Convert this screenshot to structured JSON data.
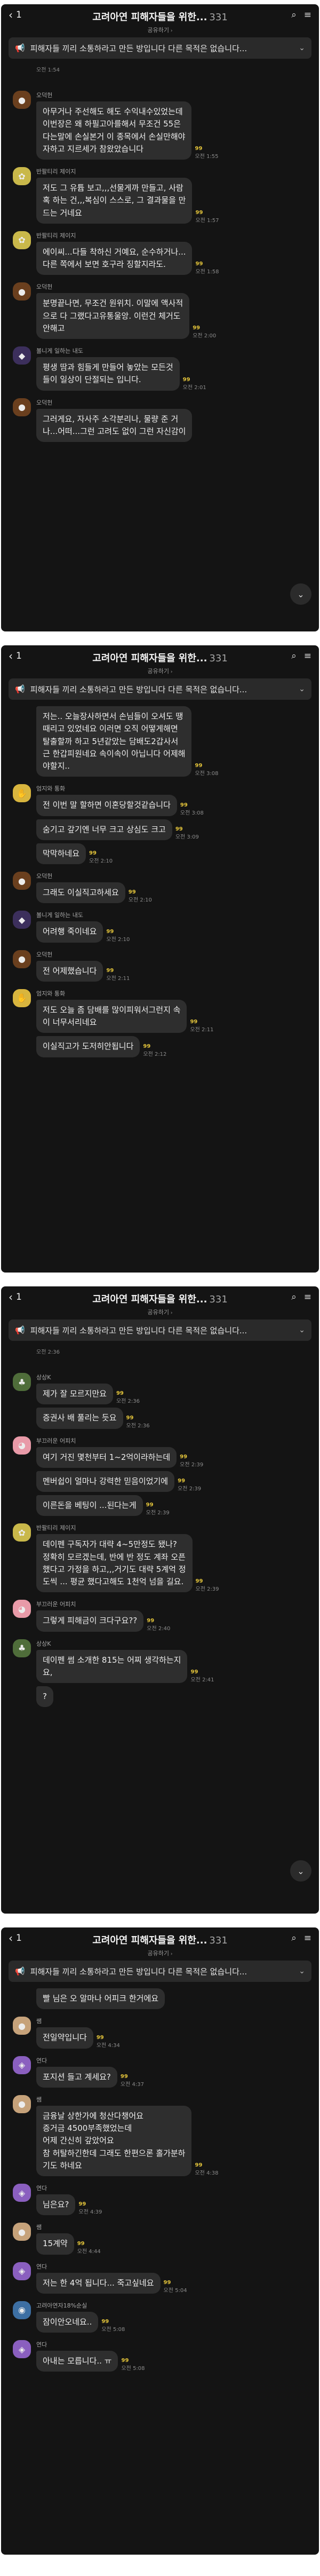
{
  "panels": [
    {
      "header": {
        "back_label": "1",
        "title": "고려아연 피해자들을 위한...",
        "count": "331",
        "subtitle": "공유하기"
      },
      "notice": "피해자들 끼리  소통하라고 만든 방입니다 다른 목적은 없습니다...",
      "messages": [
        {
          "sender": "",
          "text": "",
          "unread": "",
          "time": "오전 1:54",
          "avatar": "",
          "color": ""
        },
        {
          "sender": "오덕헌",
          "text": "아무거나 주선해도 해도 수익내수있었는데\n이번장은 왜 하필고아를해서 무조건 55은\n다는말에 손실본거 이 종목에서 손실만해야\n자하고 지르세가 참왔았습니다",
          "unread": "99",
          "time": "오전 1:55",
          "avatar": "●",
          "color": "#6a3f1e"
        },
        {
          "sender": "반팔티리 제이지",
          "text": "저도 그 유튭 보고,,,선물게까 만들고, 사람\n혹 하는 건,,,복심이 스스로, 그 결과물을 만\n드는 거네요",
          "unread": "99",
          "time": "오전 1:57",
          "avatar": "✿",
          "color": "#c9b84a"
        },
        {
          "sender": "반팔티리 제이지",
          "text": "에이씨...다들 착하신 거예요, 순수하거나...\n다른 쪽에서 보면 호구라 징할지라도.",
          "unread": "99",
          "time": "오전 1:58",
          "avatar": "✿",
          "color": "#c9b84a"
        },
        {
          "sender": "오덕헌",
          "text": "분명끝나면, 무조건 원위치. 이말에 액사적\n으로 다 그랬다고유통울앙. 이런건 체거도\n안해고",
          "unread": "99",
          "time": "오전 2:00",
          "avatar": "●",
          "color": "#6a3f1e"
        },
        {
          "sender": "볼니게 일하는 내도",
          "text": "평생 땀과 힘들게 만들어 놓았는 모든것\n들이 일상이 단절되는 입니다.",
          "unread": "99",
          "time": "오전 2:01",
          "avatar": "◆",
          "color": "#3c2f5c"
        },
        {
          "sender": "오덕헌",
          "text": "그러게요, 자사주 소각분리나, 물량 준 거\n나...어떠...그런 고려도 없이 그런 자신감이",
          "unread": "",
          "time": "",
          "avatar": "●",
          "color": "#6a3f1e"
        }
      ]
    },
    {
      "header": {
        "back_label": "1",
        "title": "고려아연 피해자들을 위한...",
        "count": "331",
        "subtitle": "공유하기"
      },
      "notice": "피해자들 끼리  소통하라고 만든 방입니다 다른 목적은 없습니다...",
      "messages": [
        {
          "sender": "",
          "text": "저는.. 오늘장사하면서 손님들이 오셔도 땡\n때리고 있었네요 이러면 오직 어떻게해면\n탈출할까 하고 5년같았는 담배도2갑사서\n근 한갑피원네요 속이속이 아닙니다 어제해\n야할지..",
          "unread": "99",
          "time": "오전 3:08",
          "avatar": "",
          "color": ""
        },
        {
          "sender": "엄지와 통화",
          "text": "전 이번 말 할하면 이혼당할것같습니다",
          "unread": "99",
          "time": "오전 3:08",
          "avatar": "✋",
          "color": "#d8b53e"
        },
        {
          "sender": "",
          "text": "숨기고 갚기엔 너무 크고 상심도 크고",
          "unread": "99",
          "time": "오전 3:09",
          "avatar": "",
          "color": ""
        },
        {
          "sender": "",
          "text": "막막하네요",
          "unread": "99",
          "time": "오전 2:10",
          "avatar": "",
          "color": ""
        },
        {
          "sender": "오덕헌",
          "text": "그래도 이실직고하세요",
          "unread": "99",
          "time": "오전 2:10",
          "avatar": "●",
          "color": "#6a3f1e"
        },
        {
          "sender": "볼니게 일하는 내도",
          "text": "어려행 죽이네요",
          "unread": "99",
          "time": "오전 2:10",
          "avatar": "◆",
          "color": "#3c2f5c"
        },
        {
          "sender": "오덕헌",
          "text": "전 어제했습니다",
          "unread": "99",
          "time": "오전 2:11",
          "avatar": "●",
          "color": "#6a3f1e"
        },
        {
          "sender": "엄지와 통화",
          "text": "저도 오늘 좀 담배를 많이피워서그런지 속\n이 너무서리네요",
          "unread": "99",
          "time": "오전 2:11",
          "avatar": "✋",
          "color": "#d8b53e"
        },
        {
          "sender": "",
          "text": "이실직고가 도저히안됩니다",
          "unread": "99",
          "time": "오전 2:12",
          "avatar": "",
          "color": ""
        }
      ]
    },
    {
      "header": {
        "back_label": "1",
        "title": "고려아연 피해자들을 위한...",
        "count": "331",
        "subtitle": "공유하기"
      },
      "notice": "피해자들 끼리  소통하라고 만든 방입니다 다른 목적은 없습니다...",
      "messages": [
        {
          "sender": "",
          "text": "",
          "unread": "",
          "time": "오전 2:36",
          "avatar": "",
          "color": ""
        },
        {
          "sender": "상상K",
          "text": "제가 잘 모르지만요",
          "unread": "99",
          "time": "오전 2:36",
          "avatar": "♣",
          "color": "#4f6d3a"
        },
        {
          "sender": "",
          "text": "증권사 배 풀리는 듯요",
          "unread": "99",
          "time": "오전 2:36",
          "avatar": "",
          "color": ""
        },
        {
          "sender": "부끄러운 어피치",
          "text": "여기 거진 몇천부터 1~2억이라하는데",
          "unread": "99",
          "time": "오전 2:39",
          "avatar": "◕",
          "color": "#e89aa8"
        },
        {
          "sender": "",
          "text": "멘버쉽이 얼마나 강력한 믿음이었기에",
          "unread": "99",
          "time": "오전 2:39",
          "avatar": "",
          "color": ""
        },
        {
          "sender": "",
          "text": "이른돈을 베팅이 ...된다는게",
          "unread": "99",
          "time": "오전 2:39",
          "avatar": "",
          "color": ""
        },
        {
          "sender": "반팔티리 제이지",
          "text": "데이펜 구독자가 대략 4~5만정도 됐나?\n정확히 모르겠는데, 반에 반 정도 계좌 오픈\n했다고 가정을 하고,,,거기도 대략 5계억 정\n도씩 ... 평균 했다고해도 1천억 넘을 길요.",
          "unread": "99",
          "time": "오전 2:39",
          "avatar": "✿",
          "color": "#c9b84a"
        },
        {
          "sender": "부끄러운 어피치",
          "text": "그렇게 피해금이 크다구요??",
          "unread": "99",
          "time": "오전 2:40",
          "avatar": "◕",
          "color": "#e89aa8"
        },
        {
          "sender": "상상K",
          "text": "데이펜 썸 소개한 815는 어찌 생각하는지\n요,",
          "unread": "99",
          "time": "오전 2:41",
          "avatar": "♣",
          "color": "#4f6d3a"
        },
        {
          "sender": "",
          "text": "?",
          "unread": "",
          "time": "",
          "avatar": "",
          "color": ""
        }
      ]
    },
    {
      "header": {
        "back_label": "1",
        "title": "고려아연 피해자들을 위한...",
        "count": "331",
        "subtitle": "공유하기"
      },
      "notice": "피해자들 끼리  소통하라고 만든 방입니다 다른 목적은 없습니다...",
      "messages": [
        {
          "sender": "",
          "text": "빨 님은 오 알마나 어피크 한거에요",
          "unread": "",
          "time": "",
          "avatar": "",
          "color": ""
        },
        {
          "sender": "쌤",
          "text": "전일약입니다",
          "unread": "99",
          "time": "오전 4:34",
          "avatar": "●",
          "color": "#c6a27a"
        },
        {
          "sender": "연다",
          "text": "포지션 들고 계세요?",
          "unread": "99",
          "time": "오전 4:37",
          "avatar": "◈",
          "color": "#8a5fbf"
        },
        {
          "sender": "쌤",
          "text": "금융날 상한가에 청산다챙어요\n증거금 4500부족했었는데\n어제 간신히 갚았어요\n참 허탈하긴한데 그래도 한편으론 홀가분하\n기도 하네요",
          "unread": "99",
          "time": "오전 4:38",
          "avatar": "●",
          "color": "#c6a27a"
        },
        {
          "sender": "연다",
          "text": "님은요?",
          "unread": "99",
          "time": "오전 4:39",
          "avatar": "◈",
          "color": "#8a5fbf"
        },
        {
          "sender": "쌤",
          "text": "15계약",
          "unread": "99",
          "time": "오전 4:44",
          "avatar": "●",
          "color": "#c6a27a"
        },
        {
          "sender": "연다",
          "text": "저는 한 4억 됩니다... 죽고싶네요",
          "unread": "99",
          "time": "오전 5:04",
          "avatar": "◈",
          "color": "#8a5fbf"
        },
        {
          "sender": "고려아연자18%순실",
          "text": "잠이안오네요..",
          "unread": "99",
          "time": "오전 5:08",
          "avatar": "◉",
          "color": "#3d6fa3"
        },
        {
          "sender": "연다",
          "text": "아내는 모릅니다.. ㅠ",
          "unread": "99",
          "time": "오전 5:08",
          "avatar": "◈",
          "color": "#8a5fbf"
        }
      ]
    }
  ],
  "icons": {
    "back": "chevron-left-icon",
    "search": "search-icon",
    "menu": "menu-icon",
    "notice": "megaphone-icon",
    "notice_expand": "chevron-down-icon",
    "scroll_down": "chevron-down-icon"
  }
}
